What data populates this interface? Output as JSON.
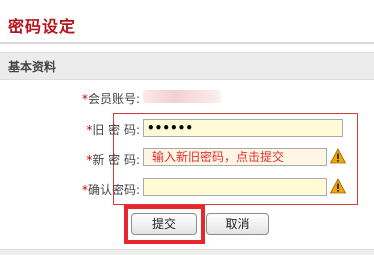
{
  "page": {
    "title": "密码设定"
  },
  "section": {
    "title": "基本资料"
  },
  "form": {
    "required_mark": "*",
    "account": {
      "label": "会员账号:"
    },
    "old_password": {
      "label": "旧 密 码:",
      "value": "••••••"
    },
    "new_password": {
      "label": "新 密 码:",
      "hint": "输入新旧密码，点击提交"
    },
    "confirm_password": {
      "label": "确认密码:",
      "value": ""
    }
  },
  "buttons": {
    "submit": "提交",
    "cancel": "取消"
  },
  "colors": {
    "title": "#b5141b",
    "required": "#cc0000",
    "highlight": "#e8262e",
    "input_bg": "#fffbd6",
    "warning": "#f0a500"
  },
  "icons": {
    "field_warning": "warning-triangle-icon"
  }
}
